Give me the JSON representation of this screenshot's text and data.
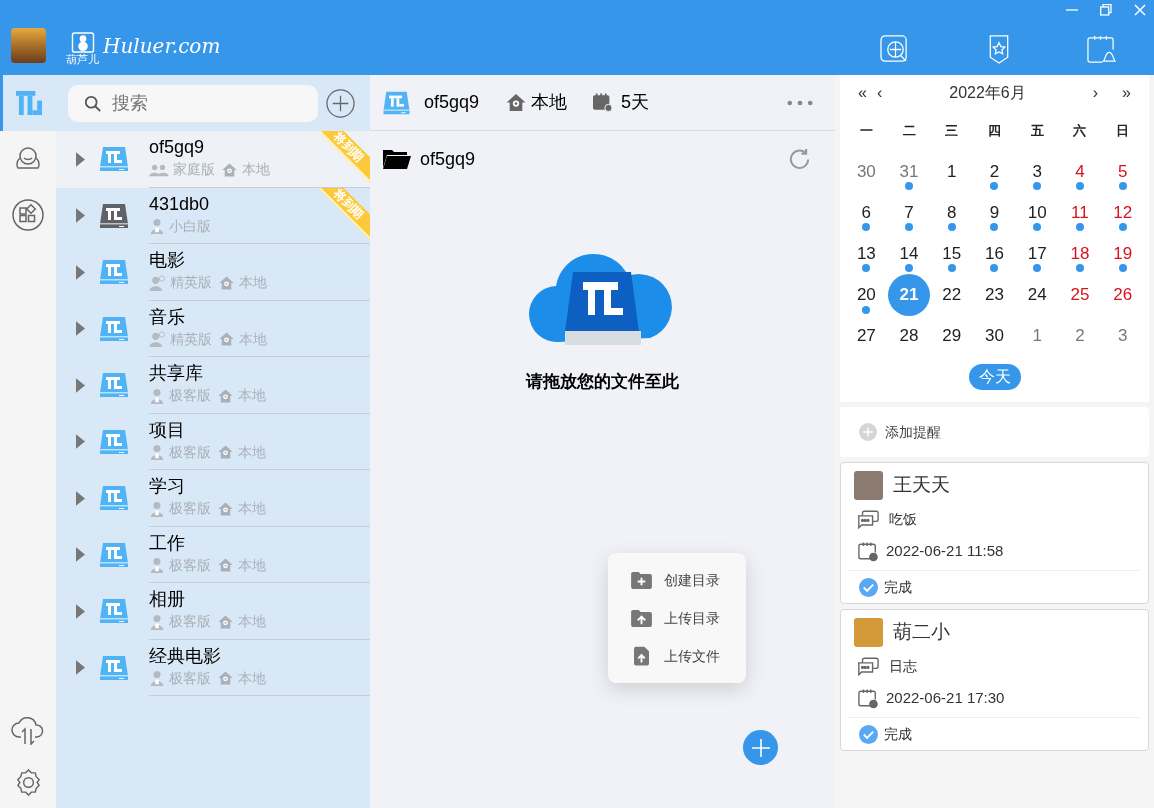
{
  "header": {
    "logo_caption": "葫芦儿",
    "logo_text": "Huluer.com"
  },
  "search": {
    "placeholder": "搜索"
  },
  "rail": [
    {
      "kind": "drive",
      "selected": true
    },
    {
      "kind": "contacts",
      "selected": false
    },
    {
      "kind": "apps",
      "selected": false
    }
  ],
  "libraries": [
    {
      "name": "of5gq9",
      "edition": "家庭版",
      "kind": "family",
      "location": "本地",
      "badge": "将到期",
      "color": "#4fb3f6",
      "selected": true,
      "expanded": false
    },
    {
      "name": "431db0",
      "edition": "小白版",
      "kind": "basic",
      "badge": "将到期",
      "color": "#5f6266",
      "selected": false,
      "expanded": false
    },
    {
      "name": "电影",
      "edition": "精英版",
      "kind": "elite",
      "location": "本地",
      "color": "#4fb3f6",
      "selected": false,
      "expanded": false
    },
    {
      "name": "音乐",
      "edition": "精英版",
      "kind": "elite",
      "location": "本地",
      "color": "#4fb3f6",
      "selected": false,
      "expanded": false
    },
    {
      "name": "共享库",
      "edition": "极客版",
      "kind": "geek",
      "location": "本地",
      "color": "#4fb3f6",
      "selected": false,
      "expanded": false
    },
    {
      "name": "项目",
      "edition": "极客版",
      "kind": "geek",
      "location": "本地",
      "color": "#4fb3f6",
      "selected": false,
      "expanded": false
    },
    {
      "name": "学习",
      "edition": "极客版",
      "kind": "geek",
      "location": "本地",
      "color": "#4fb3f6",
      "selected": false,
      "expanded": false
    },
    {
      "name": "工作",
      "edition": "极客版",
      "kind": "geek",
      "location": "本地",
      "color": "#4fb3f6",
      "selected": false,
      "expanded": false
    },
    {
      "name": "相册",
      "edition": "极客版",
      "kind": "geek",
      "location": "本地",
      "color": "#4fb3f6",
      "selected": false,
      "expanded": false
    },
    {
      "name": "经典电影",
      "edition": "极客版",
      "kind": "geek",
      "location": "本地",
      "color": "#4fb3f6",
      "selected": false,
      "expanded": false
    }
  ],
  "toolbar": {
    "library": "of5gq9",
    "location": "本地",
    "days": "5天"
  },
  "breadcrumb": "of5gq9",
  "drop_hint": "请拖放您的文件至此",
  "menu": [
    {
      "kind": "new-folder",
      "label": "创建目录"
    },
    {
      "kind": "upload-folder",
      "label": "上传目录"
    },
    {
      "kind": "upload-file",
      "label": "上传文件"
    }
  ],
  "calendar": {
    "first": "«",
    "prev": "‹",
    "title": "2022年6月",
    "next": "›",
    "last": "»",
    "weekdays": [
      "一",
      "二",
      "三",
      "四",
      "五",
      "六",
      "日"
    ],
    "weeks": [
      [
        {
          "d": "30",
          "kind": "other",
          "dot": false,
          "selected": false
        },
        {
          "d": "31",
          "kind": "other",
          "dot": true,
          "selected": false
        },
        {
          "d": "1",
          "kind": "day",
          "dot": false,
          "selected": false
        },
        {
          "d": "2",
          "kind": "day",
          "dot": true,
          "selected": false
        },
        {
          "d": "3",
          "kind": "day",
          "dot": true,
          "selected": false
        },
        {
          "d": "4",
          "kind": "weekend",
          "dot": true,
          "selected": false
        },
        {
          "d": "5",
          "kind": "weekend",
          "dot": true,
          "selected": false
        }
      ],
      [
        {
          "d": "6",
          "kind": "day",
          "dot": true,
          "selected": false
        },
        {
          "d": "7",
          "kind": "day",
          "dot": true,
          "selected": false
        },
        {
          "d": "8",
          "kind": "day",
          "dot": true,
          "selected": false
        },
        {
          "d": "9",
          "kind": "day",
          "dot": true,
          "selected": false
        },
        {
          "d": "10",
          "kind": "day",
          "dot": true,
          "selected": false
        },
        {
          "d": "11",
          "kind": "weekend",
          "dot": true,
          "selected": false
        },
        {
          "d": "12",
          "kind": "weekend",
          "dot": true,
          "selected": false
        }
      ],
      [
        {
          "d": "13",
          "kind": "day",
          "dot": true,
          "selected": false
        },
        {
          "d": "14",
          "kind": "day",
          "dot": true,
          "selected": false
        },
        {
          "d": "15",
          "kind": "day",
          "dot": true,
          "selected": false
        },
        {
          "d": "16",
          "kind": "day",
          "dot": true,
          "selected": false
        },
        {
          "d": "17",
          "kind": "day",
          "dot": true,
          "selected": false
        },
        {
          "d": "18",
          "kind": "weekend",
          "dot": true,
          "selected": false
        },
        {
          "d": "19",
          "kind": "weekend",
          "dot": true,
          "selected": false
        }
      ],
      [
        {
          "d": "20",
          "kind": "day",
          "dot": true,
          "selected": false
        },
        {
          "d": "21",
          "kind": "day",
          "dot": false,
          "selected": true
        },
        {
          "d": "22",
          "kind": "day",
          "dot": false,
          "selected": false
        },
        {
          "d": "23",
          "kind": "day",
          "dot": false,
          "selected": false
        },
        {
          "d": "24",
          "kind": "day",
          "dot": false,
          "selected": false
        },
        {
          "d": "25",
          "kind": "weekend",
          "dot": false,
          "selected": false
        },
        {
          "d": "26",
          "kind": "weekend",
          "dot": false,
          "selected": false
        }
      ],
      [
        {
          "d": "27",
          "kind": "day",
          "dot": false,
          "selected": false
        },
        {
          "d": "28",
          "kind": "day",
          "dot": false,
          "selected": false
        },
        {
          "d": "29",
          "kind": "day",
          "dot": false,
          "selected": false
        },
        {
          "d": "30",
          "kind": "day",
          "dot": false,
          "selected": false
        },
        {
          "d": "1",
          "kind": "other",
          "dot": false,
          "selected": false
        },
        {
          "d": "2",
          "kind": "other",
          "dot": false,
          "selected": false
        },
        {
          "d": "3",
          "kind": "other",
          "dot": false,
          "selected": false
        }
      ]
    ],
    "today": "今天"
  },
  "add_reminder": "添加提醒",
  "reminders": [
    {
      "name": "王天天",
      "note": "吃饭",
      "time": "2022-06-21 11:58",
      "status": "完成",
      "done": true
    },
    {
      "name": "葫二小",
      "note": "日志",
      "time": "2022-06-21 17:30",
      "status": "完成",
      "done": true
    }
  ]
}
